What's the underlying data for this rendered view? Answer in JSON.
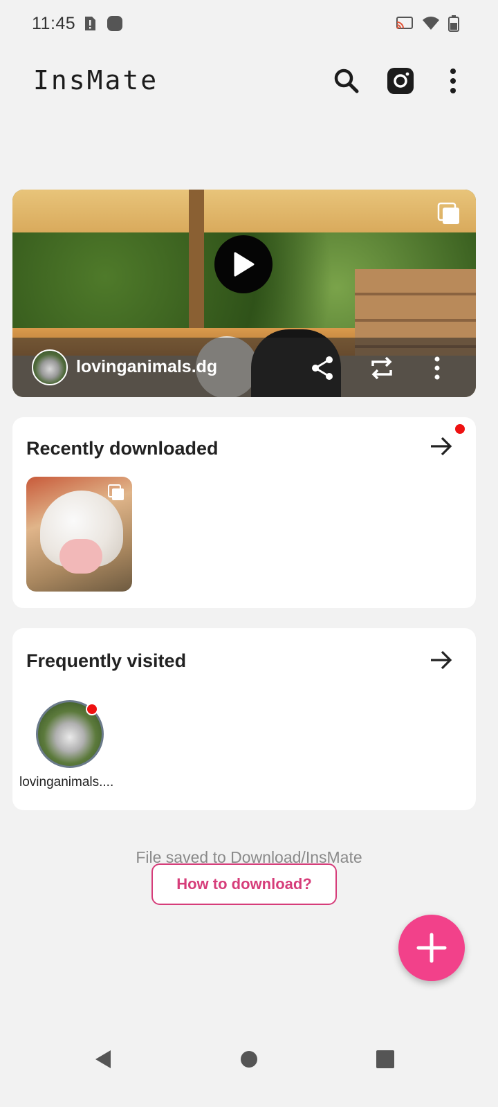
{
  "status_bar": {
    "time": "11:45",
    "left_icons": [
      "sim-alert-icon",
      "notification-dot-icon"
    ],
    "right_icons": [
      "cast-icon",
      "wifi-icon",
      "battery-icon"
    ]
  },
  "app_bar": {
    "title": "InsMate",
    "actions": [
      "search-icon",
      "instagram-icon",
      "more-vertical-icon"
    ]
  },
  "hero": {
    "username": "lovinganimals.dg",
    "actions": [
      "share-icon",
      "repost-icon",
      "more-vertical-icon"
    ]
  },
  "recently_downloaded": {
    "title": "Recently downloaded",
    "has_new": true
  },
  "frequently_visited": {
    "title": "Frequently visited",
    "items": [
      {
        "label": "lovinganimals....",
        "has_new": true
      }
    ]
  },
  "footer": {
    "save_path_text": "File saved to Download/InsMate",
    "how_to_button": "How to download?"
  },
  "colors": {
    "accent": "#f2418a",
    "accent_outline": "#d63d7a",
    "notification_dot": "#ee1111",
    "background": "#f2f2f2"
  },
  "nav_bar": [
    "back-icon",
    "home-icon",
    "recents-icon"
  ]
}
